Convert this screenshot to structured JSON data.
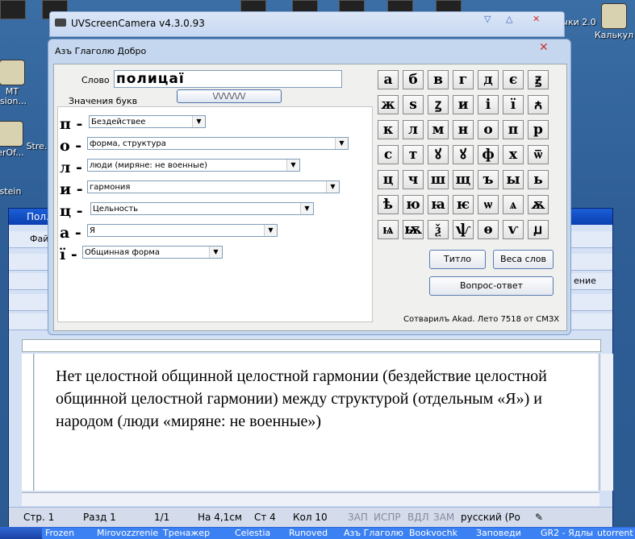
{
  "desktop": {
    "icons": [
      {
        "name": "desktop-icon-1",
        "label": "MT ision..."
      },
      {
        "name": "desktop-icon-2",
        "label": "erOf..."
      },
      {
        "name": "desktop-icon-3",
        "label": "Stre..."
      },
      {
        "name": "desktop-icon-4",
        "label": "stein"
      },
      {
        "name": "desktop-icon-5",
        "label": "Калькул"
      },
      {
        "name": "desktop-icon-6",
        "label": "ыки 2.0"
      }
    ]
  },
  "uvsc": {
    "title": "UVScreenCamera v4.3.0.93",
    "controls": [
      "▽",
      "△",
      "✕"
    ]
  },
  "dialog": {
    "title": "Азъ Глаголю Добро",
    "close": "✕",
    "word_label": "Слово",
    "word_value": "полицаї",
    "wave_button": "\\/\\/\\/\\/\\/\\/",
    "meanings_label": "Значения букв",
    "letters": [
      {
        "letter": "п",
        "meaning": "Бездействее"
      },
      {
        "letter": "о",
        "meaning": "форма, структура"
      },
      {
        "letter": "л",
        "meaning": "люди (миряне: не военные)"
      },
      {
        "letter": "и",
        "meaning": "гармония"
      },
      {
        "letter": "ц",
        "meaning": "Цельность"
      },
      {
        "letter": "а",
        "meaning": "Я"
      },
      {
        "letter": "ї",
        "meaning": "Общинная форма"
      }
    ],
    "keyboard": [
      [
        "а",
        "б",
        "в",
        "г",
        "д",
        "є",
        "ꙃ"
      ],
      [
        "ж",
        "ѕ",
        "ꙁ",
        "и",
        "і",
        "ї",
        "ꙉ"
      ],
      [
        "к",
        "л",
        "м",
        "н",
        "о",
        "п",
        "р"
      ],
      [
        "с",
        "т",
        "ꙋ",
        "ꙋ",
        "ф",
        "х",
        "ѿ"
      ],
      [
        "ц",
        "ч",
        "ш",
        "щ",
        "ъ",
        "ы",
        "ь"
      ],
      [
        "ѣ",
        "ю",
        "ꙗ",
        "ѥ",
        "ѡ",
        "ѧ",
        "ѫ"
      ],
      [
        "ѩ",
        "ѭ",
        "ѯ",
        "ѱ",
        "ѳ",
        "ѵ",
        "ꙡ"
      ]
    ],
    "titlo_button": "Титло",
    "weights_button": "Веса слов",
    "qa_button": "Вопрос-ответ",
    "credit": "Сотварилъ Akad. Лето 7518 от СМЗХ"
  },
  "word": {
    "title": "Пол...",
    "menu_file": "Фай",
    "toolbar_right": "ение",
    "document_text": "Нет целостной общинной целостной гармонии (бездействие целостной общинной целостной гармонии) между структурой (отдельным «Я») и народом (люди «миряне: не военные»)",
    "status": {
      "page": "Стр. 1",
      "section": "Разд 1",
      "pages": "1/1",
      "at": "На 4,1см",
      "line": "Ст 4",
      "col": "Кол 10",
      "rec": "ЗАП",
      "trk": "ИСПР",
      "ext": "ВДЛ",
      "ovr": "ЗАМ",
      "lang": "русский (Ро"
    }
  },
  "taskbar": {
    "items": [
      "Frozen",
      "Mirovozzrenie",
      "Тренажер",
      "Celestia",
      "Runoved",
      "Азъ Глаголю",
      "Bookvochk",
      "Заповеди",
      "GR2 - Ядлык",
      "utorrent"
    ]
  }
}
